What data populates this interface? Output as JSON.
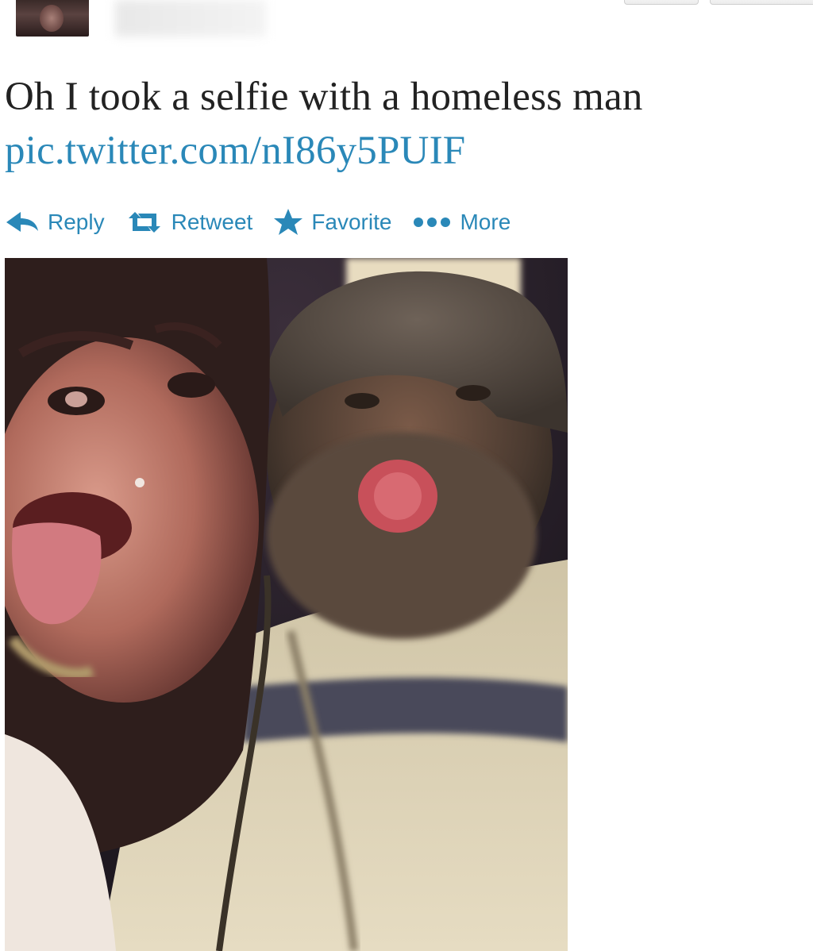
{
  "tweet": {
    "text": "Oh I took a selfie with a homeless man",
    "link": "pic.twitter.com/nI86y5PUIF"
  },
  "actions": [
    {
      "label": "Reply",
      "icon": "reply-icon"
    },
    {
      "label": "Retweet",
      "icon": "retweet-icon"
    },
    {
      "label": "Favorite",
      "icon": "star-icon"
    },
    {
      "label": "More",
      "icon": "more-dots-icon"
    }
  ],
  "colors": {
    "link": "#2a88b8",
    "text": "#222222",
    "background": "#ffffff"
  }
}
